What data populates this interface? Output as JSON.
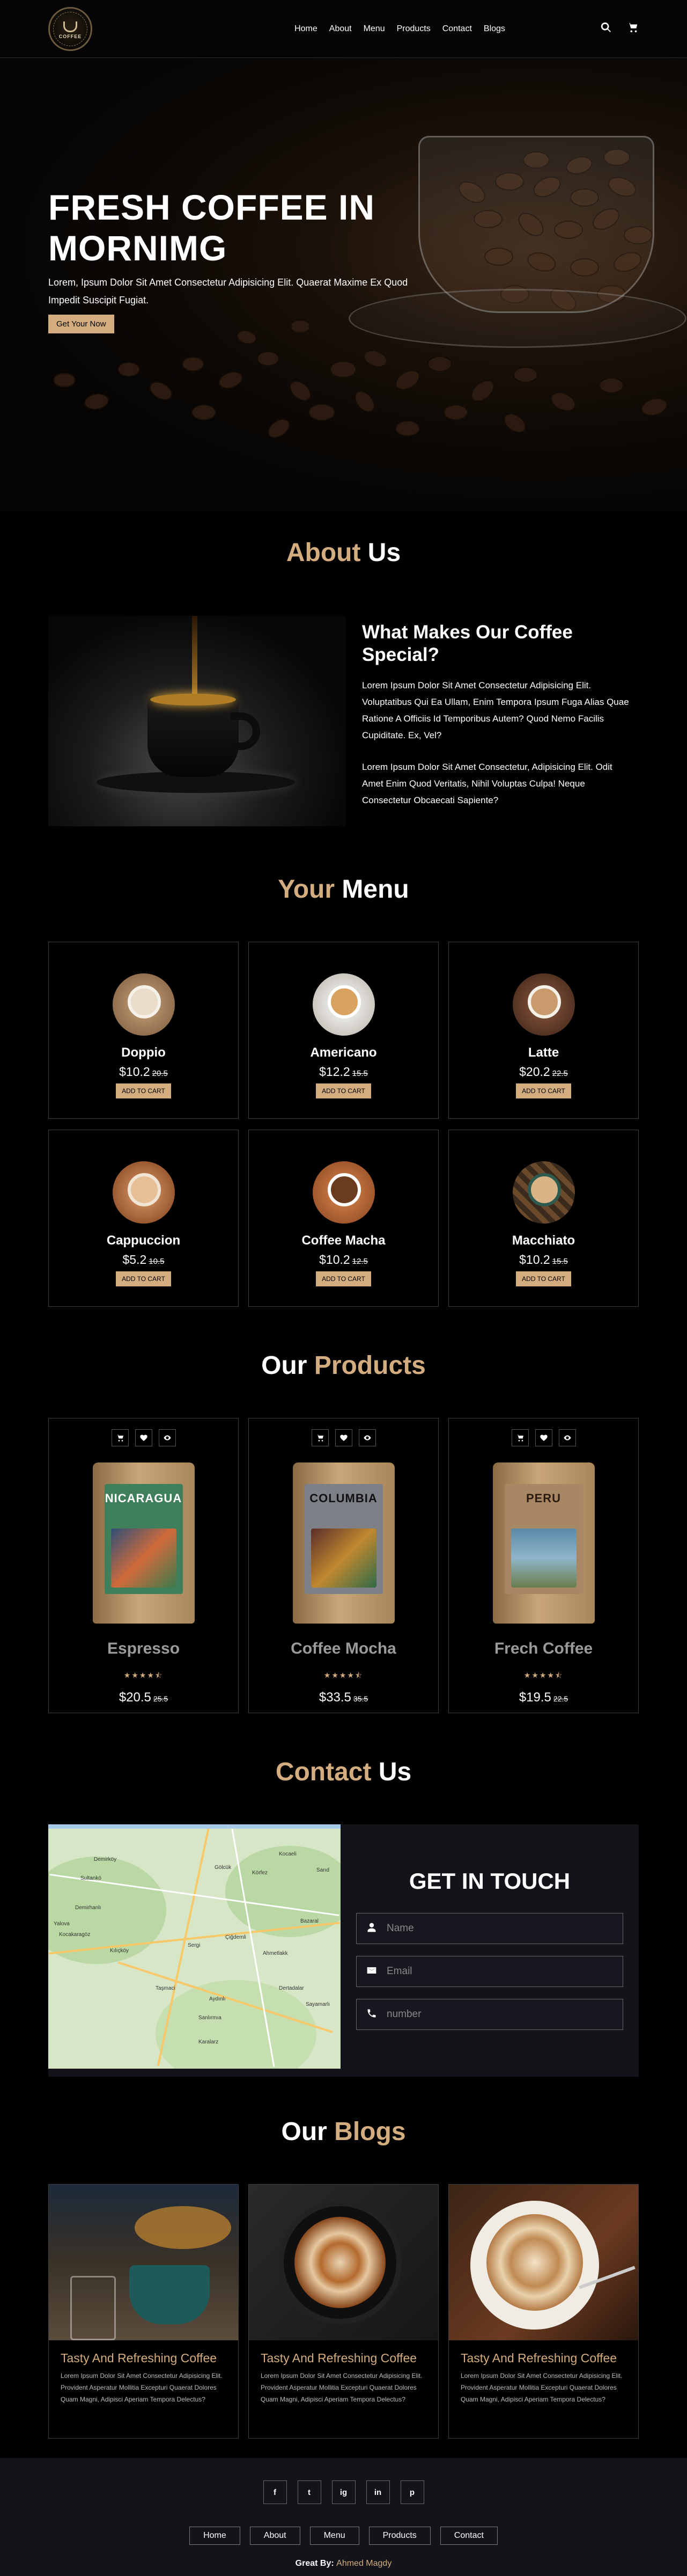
{
  "header": {
    "logo_text": "COFFEE",
    "nav": [
      "Home",
      "About",
      "Menu",
      "Products",
      "Contact",
      "Blogs"
    ],
    "icons": [
      "search-icon",
      "cart-icon"
    ]
  },
  "hero": {
    "title": "FRESH COFFEE IN MORNIMG",
    "text": "Lorem, Ipsum Dolor Sit Amet Consectetur Adipisicing Elit. Quaerat Maxime Ex Quod Impedit Suscipit Fugiat.",
    "button": "Get Your Now"
  },
  "about": {
    "title_accent": "About",
    "title_rest": "Us",
    "heading": "What Makes Our Coffee Special?",
    "p1": "Lorem Ipsum Dolor Sit Amet Consectetur Adipisicing Elit. Voluptatibus Qui Ea Ullam, Enim Tempora Ipsum Fuga Alias Quae Ratione A Officiis Id Temporibus Autem? Quod Nemo Facilis Cupiditate. Ex, Vel?",
    "p2": "Lorem Ipsum Dolor Sit Amet Consectetur, Adipisicing Elit. Odit Amet Enim Quod Veritatis, Nihil Voluptas Culpa! Neque Consectetur Obcaecati Sapiente?"
  },
  "menu": {
    "title_accent": "Your",
    "title_rest": "Menu",
    "button": "ADD TO CART",
    "items": [
      {
        "name": "Doppio",
        "price": "$10.2",
        "old": "20.5",
        "color": "#7a5a3c"
      },
      {
        "name": "Americano",
        "price": "$12.2",
        "old": "15.5",
        "color": "#d9d3c6"
      },
      {
        "name": "Latte",
        "price": "$20.2",
        "old": "22.5",
        "color": "#5a3524"
      },
      {
        "name": "Cappuccion",
        "price": "$5.2",
        "old": "10.5",
        "color": "#a2562c"
      },
      {
        "name": "Coffee Macha",
        "price": "$10.2",
        "old": "12.5",
        "color": "#b0693a"
      },
      {
        "name": "Macchiato",
        "price": "$10.2",
        "old": "15.5",
        "color": "#3b5a52"
      }
    ]
  },
  "products": {
    "title_accent": "Products",
    "title_prefix": "Our",
    "items": [
      {
        "name": "Espresso",
        "bag_title": "NICARAGUA",
        "price": "$20.5",
        "old": "25.5",
        "label": "#3f7f5c",
        "pic": "#2f4f78"
      },
      {
        "name": "Coffee Mocha",
        "bag_title": "COLUMBIA",
        "price": "$33.5",
        "old": "35.5",
        "label": "#7d8086",
        "pic": "#5a2e2a"
      },
      {
        "name": "Frech Coffee",
        "bag_title": "PERU",
        "price": "$19.5",
        "old": "22.5",
        "label": "#a88765",
        "pic": "#5b89a8"
      }
    ],
    "stars": "★★★★⯪"
  },
  "contact": {
    "title_accent": "Contact",
    "title_rest": "Us",
    "form_title": "GET IN TOUCH",
    "placeholders": {
      "name": "Name",
      "email": "Email",
      "number": "number"
    },
    "map_labels": [
      "Demirköy",
      "Sultankö",
      "Gölcük",
      "Kocaeli",
      "Körfez",
      "Sarıd",
      "Demirhanlı",
      "Yalova",
      "Kocakaragöz",
      "Kılıçköy",
      "Sergi",
      "Çiğdemli",
      "Ahmetlakk",
      "Bazaral",
      "Dertadalar",
      "Aydınlı",
      "Sayamarlı",
      "Taşmaci",
      "Sanlırmıa",
      "Karalarz"
    ]
  },
  "blogs": {
    "title_prefix": "Our",
    "title_accent": "Blogs",
    "items": [
      {
        "title": "Tasty And Refreshing Coffee",
        "text": "Lorem Ipsum Dolor Sit Amet Consectetur Adipisicing Elit. Provident Asperatur Mollitia Excepturi Quaerat Dolores Quam Magni, Adipisci Aperiam Tempora Delectus?"
      },
      {
        "title": "Tasty And Refreshing Coffee",
        "text": "Lorem Ipsum Dolor Sit Amet Consectetur Adipisicing Elit. Provident Asperatur Mollitia Excepturi Quaerat Dolores Quam Magni, Adipisci Aperiam Tempora Delectus?"
      },
      {
        "title": "Tasty And Refreshing Coffee",
        "text": "Lorem Ipsum Dolor Sit Amet Consectetur Adipisicing Elit. Provident Asperatur Mollitia Excepturi Quaerat Dolores Quam Magni, Adipisci Aperiam Tempora Delectus?"
      }
    ]
  },
  "footer": {
    "social": [
      "f",
      "t",
      "ig",
      "in",
      "p"
    ],
    "social_icons": [
      "facebook-icon",
      "twitter-icon",
      "instagram-icon",
      "linkedin-icon",
      "pinterest-icon"
    ],
    "nav": [
      "Home",
      "About",
      "Menu",
      "Products",
      "Contact"
    ],
    "credit_prefix": "Great By:",
    "credit_name": "Ahmed Magdy"
  },
  "colors": {
    "accent": "#d3ad7f",
    "background": "#000000",
    "panel": "#13131a"
  }
}
